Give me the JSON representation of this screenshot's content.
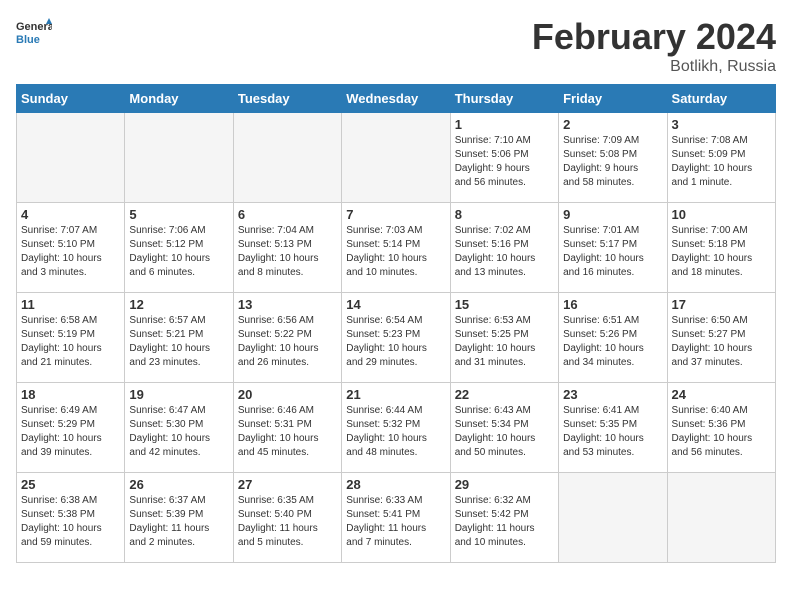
{
  "header": {
    "logo_line1": "General",
    "logo_line2": "Blue",
    "title": "February 2024",
    "subtitle": "Botlikh, Russia"
  },
  "days_of_week": [
    "Sunday",
    "Monday",
    "Tuesday",
    "Wednesday",
    "Thursday",
    "Friday",
    "Saturday"
  ],
  "weeks": [
    [
      {
        "num": "",
        "info": ""
      },
      {
        "num": "",
        "info": ""
      },
      {
        "num": "",
        "info": ""
      },
      {
        "num": "",
        "info": ""
      },
      {
        "num": "1",
        "info": "Sunrise: 7:10 AM\nSunset: 5:06 PM\nDaylight: 9 hours\nand 56 minutes."
      },
      {
        "num": "2",
        "info": "Sunrise: 7:09 AM\nSunset: 5:08 PM\nDaylight: 9 hours\nand 58 minutes."
      },
      {
        "num": "3",
        "info": "Sunrise: 7:08 AM\nSunset: 5:09 PM\nDaylight: 10 hours\nand 1 minute."
      }
    ],
    [
      {
        "num": "4",
        "info": "Sunrise: 7:07 AM\nSunset: 5:10 PM\nDaylight: 10 hours\nand 3 minutes."
      },
      {
        "num": "5",
        "info": "Sunrise: 7:06 AM\nSunset: 5:12 PM\nDaylight: 10 hours\nand 6 minutes."
      },
      {
        "num": "6",
        "info": "Sunrise: 7:04 AM\nSunset: 5:13 PM\nDaylight: 10 hours\nand 8 minutes."
      },
      {
        "num": "7",
        "info": "Sunrise: 7:03 AM\nSunset: 5:14 PM\nDaylight: 10 hours\nand 10 minutes."
      },
      {
        "num": "8",
        "info": "Sunrise: 7:02 AM\nSunset: 5:16 PM\nDaylight: 10 hours\nand 13 minutes."
      },
      {
        "num": "9",
        "info": "Sunrise: 7:01 AM\nSunset: 5:17 PM\nDaylight: 10 hours\nand 16 minutes."
      },
      {
        "num": "10",
        "info": "Sunrise: 7:00 AM\nSunset: 5:18 PM\nDaylight: 10 hours\nand 18 minutes."
      }
    ],
    [
      {
        "num": "11",
        "info": "Sunrise: 6:58 AM\nSunset: 5:19 PM\nDaylight: 10 hours\nand 21 minutes."
      },
      {
        "num": "12",
        "info": "Sunrise: 6:57 AM\nSunset: 5:21 PM\nDaylight: 10 hours\nand 23 minutes."
      },
      {
        "num": "13",
        "info": "Sunrise: 6:56 AM\nSunset: 5:22 PM\nDaylight: 10 hours\nand 26 minutes."
      },
      {
        "num": "14",
        "info": "Sunrise: 6:54 AM\nSunset: 5:23 PM\nDaylight: 10 hours\nand 29 minutes."
      },
      {
        "num": "15",
        "info": "Sunrise: 6:53 AM\nSunset: 5:25 PM\nDaylight: 10 hours\nand 31 minutes."
      },
      {
        "num": "16",
        "info": "Sunrise: 6:51 AM\nSunset: 5:26 PM\nDaylight: 10 hours\nand 34 minutes."
      },
      {
        "num": "17",
        "info": "Sunrise: 6:50 AM\nSunset: 5:27 PM\nDaylight: 10 hours\nand 37 minutes."
      }
    ],
    [
      {
        "num": "18",
        "info": "Sunrise: 6:49 AM\nSunset: 5:29 PM\nDaylight: 10 hours\nand 39 minutes."
      },
      {
        "num": "19",
        "info": "Sunrise: 6:47 AM\nSunset: 5:30 PM\nDaylight: 10 hours\nand 42 minutes."
      },
      {
        "num": "20",
        "info": "Sunrise: 6:46 AM\nSunset: 5:31 PM\nDaylight: 10 hours\nand 45 minutes."
      },
      {
        "num": "21",
        "info": "Sunrise: 6:44 AM\nSunset: 5:32 PM\nDaylight: 10 hours\nand 48 minutes."
      },
      {
        "num": "22",
        "info": "Sunrise: 6:43 AM\nSunset: 5:34 PM\nDaylight: 10 hours\nand 50 minutes."
      },
      {
        "num": "23",
        "info": "Sunrise: 6:41 AM\nSunset: 5:35 PM\nDaylight: 10 hours\nand 53 minutes."
      },
      {
        "num": "24",
        "info": "Sunrise: 6:40 AM\nSunset: 5:36 PM\nDaylight: 10 hours\nand 56 minutes."
      }
    ],
    [
      {
        "num": "25",
        "info": "Sunrise: 6:38 AM\nSunset: 5:38 PM\nDaylight: 10 hours\nand 59 minutes."
      },
      {
        "num": "26",
        "info": "Sunrise: 6:37 AM\nSunset: 5:39 PM\nDaylight: 11 hours\nand 2 minutes."
      },
      {
        "num": "27",
        "info": "Sunrise: 6:35 AM\nSunset: 5:40 PM\nDaylight: 11 hours\nand 5 minutes."
      },
      {
        "num": "28",
        "info": "Sunrise: 6:33 AM\nSunset: 5:41 PM\nDaylight: 11 hours\nand 7 minutes."
      },
      {
        "num": "29",
        "info": "Sunrise: 6:32 AM\nSunset: 5:42 PM\nDaylight: 11 hours\nand 10 minutes."
      },
      {
        "num": "",
        "info": ""
      },
      {
        "num": "",
        "info": ""
      }
    ]
  ],
  "shaded_rows": [
    1,
    3
  ]
}
